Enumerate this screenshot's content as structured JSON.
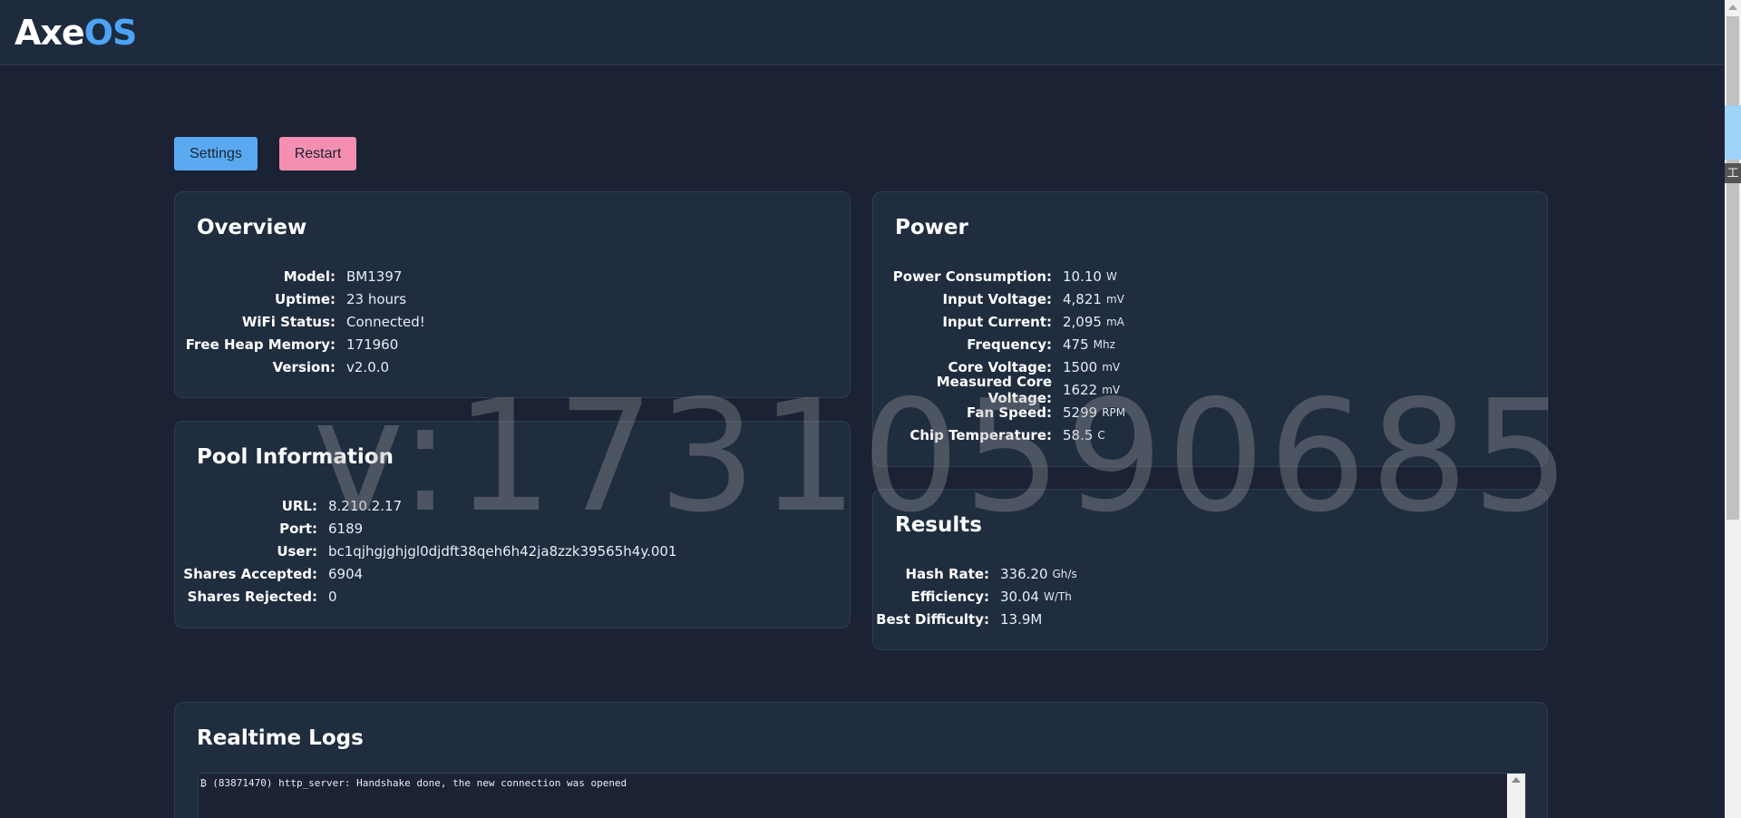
{
  "header": {
    "logo_part1": "Axe",
    "logo_part2": "OS"
  },
  "toolbar": {
    "settings_label": "Settings",
    "restart_label": "Restart"
  },
  "overview": {
    "title": "Overview",
    "rows": [
      {
        "key": "Model:",
        "value": "BM1397"
      },
      {
        "key": "Uptime:",
        "value": "23 hours"
      },
      {
        "key": "WiFi Status:",
        "value": "Connected!"
      },
      {
        "key": "Free Heap Memory:",
        "value": "171960"
      },
      {
        "key": "Version:",
        "value": "v2.0.0"
      }
    ]
  },
  "pool": {
    "title": "Pool Information",
    "rows": [
      {
        "key": "URL:",
        "value": "8.210.2.17"
      },
      {
        "key": "Port:",
        "value": "6189"
      },
      {
        "key": "User:",
        "value": "bc1qjhgjghjgl0djdft38qeh6h42ja8zzk39565h4y.001"
      },
      {
        "key": "Shares Accepted:",
        "value": "6904"
      },
      {
        "key": "Shares Rejected:",
        "value": "0"
      }
    ]
  },
  "power": {
    "title": "Power",
    "rows": [
      {
        "key": "Power Consumption:",
        "value": "10.10",
        "unit": "W"
      },
      {
        "key": "Input Voltage:",
        "value": "4,821",
        "unit": "mV"
      },
      {
        "key": "Input Current:",
        "value": "2,095",
        "unit": "mA"
      },
      {
        "key": "Frequency:",
        "value": "475",
        "unit": "Mhz"
      },
      {
        "key": "Core Voltage:",
        "value": "1500",
        "unit": "mV"
      },
      {
        "key": "Measured Core Voltage:",
        "value": "1622",
        "unit": "mV"
      },
      {
        "key": "Fan Speed:",
        "value": "5299",
        "unit": "RPM"
      },
      {
        "key": "Chip Temperature:",
        "value": "58.5",
        "unit": "C"
      }
    ]
  },
  "results": {
    "title": "Results",
    "rows": [
      {
        "key": "Hash Rate:",
        "value": "336.20",
        "unit": "Gh/s"
      },
      {
        "key": "Efficiency:",
        "value": "30.04",
        "unit": "W/Th"
      },
      {
        "key": "Best Difficulty:",
        "value": "13.9M",
        "unit": ""
      }
    ]
  },
  "logs": {
    "title": "Realtime Logs",
    "lines": [
      "₿ (83871470) http_server: Handshake done, the new connection was opened"
    ]
  },
  "watermark": "v:17310590685",
  "side_widget_char": "工"
}
